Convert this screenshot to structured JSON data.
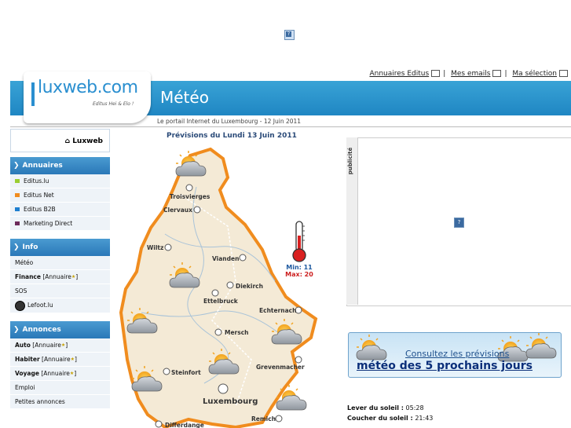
{
  "top_ad": {
    "icon": "broken-image-icon"
  },
  "top_links": [
    {
      "label": "Annuaires Editus",
      "icon": "grid-icon"
    },
    {
      "label": "Mes emails",
      "icon": "mail-icon"
    },
    {
      "label": "Ma sélection",
      "icon": "selection-icon"
    }
  ],
  "logo": {
    "name": "luxweb.com",
    "tagline": "Editus Hei & Elo !"
  },
  "header": {
    "title": "Météo",
    "subtitle": "Le portail Internet du Luxembourg - 12 Juin 2011"
  },
  "sidebar": {
    "home_label": "Luxweb",
    "sections": [
      {
        "title": "Annuaires",
        "items": [
          {
            "label": "Editus.lu",
            "color": "#9acd32"
          },
          {
            "label": "Editus Net",
            "color": "#f08c1e"
          },
          {
            "label": "Editus B2B",
            "color": "#1e7fd0"
          },
          {
            "label": "Marketing Direct",
            "color": "#6b2a5a"
          }
        ]
      },
      {
        "title": "Info",
        "items": [
          {
            "label": "Météo",
            "suffix": ""
          },
          {
            "label": "Finance",
            "suffix": "[Annuaire"
          },
          {
            "label": "SOS",
            "suffix": ""
          },
          {
            "label": "Lefoot.lu",
            "suffix": ""
          }
        ]
      },
      {
        "title": "Annonces",
        "items": [
          {
            "label": "Auto",
            "suffix": "[Annuaire"
          },
          {
            "label": "Habiter",
            "suffix": "[Annuaire"
          },
          {
            "label": "Voyage",
            "suffix": "[Annuaire"
          },
          {
            "label": "Emploi",
            "suffix": ""
          },
          {
            "label": "Petites annonces",
            "suffix": ""
          }
        ]
      }
    ]
  },
  "forecast": {
    "title": "Prévisions du Lundi 13 Juin 2011",
    "min": "Min: 11",
    "max": "Max: 20",
    "towns": [
      "Troisvierges",
      "Clervaux",
      "Wiltz",
      "Vianden",
      "Diekirch",
      "Ettelbruck",
      "Echternach",
      "Mersch",
      "Steinfort",
      "Grevenmacher",
      "Luxembourg",
      "Remich",
      "Differdange"
    ]
  },
  "ad_panel": {
    "label": "publicité",
    "icon": "broken-image-icon"
  },
  "banner": {
    "line1": "Consultez les prévisions",
    "line2": "météo des 5 prochains jours"
  },
  "sun": {
    "rise_label": "Lever du soleil :",
    "rise": "05:28",
    "set_label": "Coucher du soleil :",
    "set": "21:43"
  }
}
